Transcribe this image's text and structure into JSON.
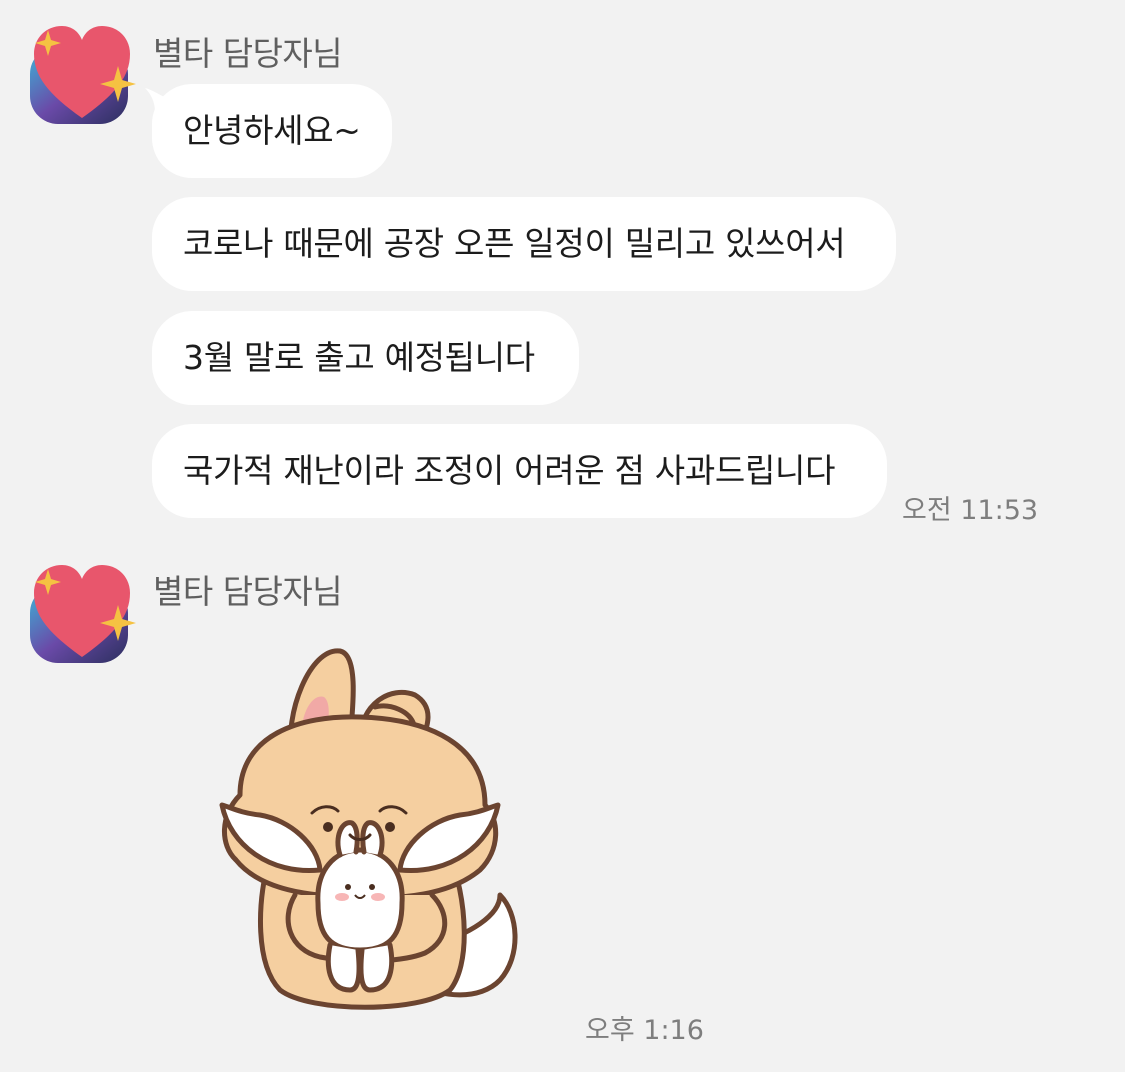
{
  "sender_name": "별타 담당자님",
  "messages": [
    {
      "text": "안녕하세요~"
    },
    {
      "text": "코로나 때문에 공장 오픈 일정이 밀리고 있쓰어서"
    },
    {
      "text": "3월 말로 출고 예정됩니다"
    },
    {
      "text": "국가적 재난이라 조정이 어려운 점 사과드립니다"
    }
  ],
  "timestamps": {
    "first_group": "오전 11:53",
    "sticker": "오후 1:16"
  },
  "avatar_icon": "sparkling-heart-icon",
  "sticker_icon": "sad-fox-hugging-bunny-sticker",
  "colors": {
    "background": "#f2f2f2",
    "bubble": "#ffffff",
    "heart": "#e8566c",
    "sparkle": "#f5c242"
  }
}
